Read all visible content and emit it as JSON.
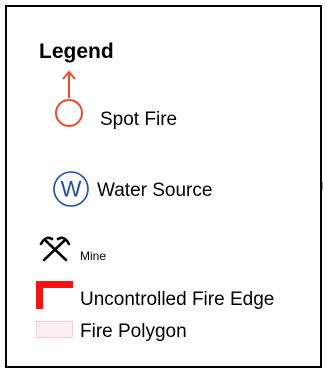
{
  "legend": {
    "title": "Legend",
    "items": [
      {
        "label": "Spot Fire",
        "icon": "spot-fire-icon",
        "color": "#f04a2a"
      },
      {
        "label": "Water Source",
        "icon": "water-source-icon",
        "color": "#1f4ea8",
        "glyph": "W"
      },
      {
        "label": "Mine",
        "icon": "mine-icon",
        "color": "#000000"
      },
      {
        "label": "Uncontrolled Fire Edge",
        "icon": "uncontrolled-fire-edge-icon",
        "color": "#f21313"
      },
      {
        "label": "Fire Polygon",
        "icon": "fire-polygon-swatch",
        "color": "#fdeef4"
      }
    ]
  }
}
